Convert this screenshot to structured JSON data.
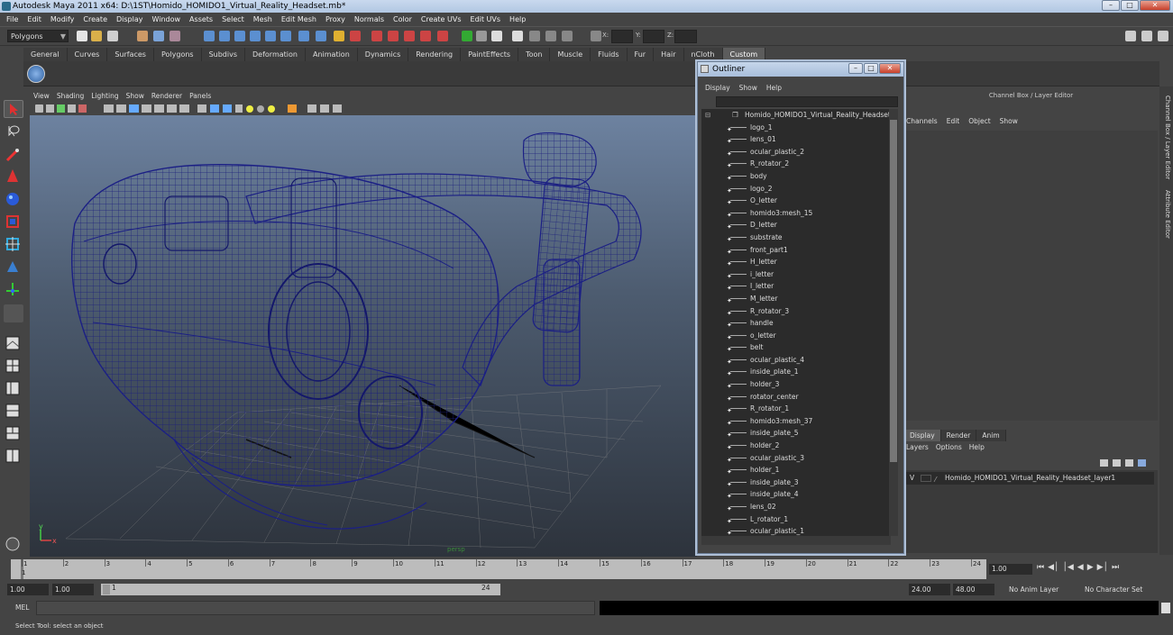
{
  "window": {
    "title": "Autodesk Maya 2011 x64: D:\\1ST\\Homido_HOMIDO1_Virtual_Reality_Headset.mb*"
  },
  "menubar": [
    "File",
    "Edit",
    "Modify",
    "Create",
    "Display",
    "Window",
    "Assets",
    "Select",
    "Mesh",
    "Edit Mesh",
    "Proxy",
    "Normals",
    "Color",
    "Create UVs",
    "Edit UVs",
    "Help"
  ],
  "toolbar": {
    "mode": "Polygons",
    "x_label": "X:",
    "y_label": "Y:",
    "z_label": "Z:"
  },
  "shelf_tabs": [
    "General",
    "Curves",
    "Surfaces",
    "Polygons",
    "Subdivs",
    "Deformation",
    "Animation",
    "Dynamics",
    "Rendering",
    "PaintEffects",
    "Toon",
    "Muscle",
    "Fluids",
    "Fur",
    "Hair",
    "nCloth",
    "Custom"
  ],
  "shelf_active": "Custom",
  "viewport": {
    "menu": [
      "View",
      "Shading",
      "Lighting",
      "Show",
      "Renderer",
      "Panels"
    ],
    "camera_label": "persp",
    "axis_x": "x",
    "axis_y": "y"
  },
  "outliner": {
    "title": "Outliner",
    "menu": [
      "Display",
      "Show",
      "Help"
    ],
    "root": "Homido_HOMIDO1_Virtual_Reality_Headset",
    "items": [
      "logo_1",
      "lens_01",
      "ocular_plastic_2",
      "R_rotator_2",
      "body",
      "logo_2",
      "O_letter",
      "homido3:mesh_15",
      "D_letter",
      "substrate",
      "front_part1",
      "H_letter",
      "i_letter",
      "I_letter",
      "M_letter",
      "R_rotator_3",
      "handle",
      "o_letter",
      "belt",
      "ocular_plastic_4",
      "inside_plate_1",
      "holder_3",
      "rotator_center",
      "R_rotator_1",
      "homido3:mesh_37",
      "inside_plate_5",
      "holder_2",
      "ocular_plastic_3",
      "holder_1",
      "inside_plate_3",
      "inside_plate_4",
      "lens_02",
      "L_rotator_1",
      "ocular_plastic_1"
    ]
  },
  "channel_box": {
    "header": "Channel Box / Layer Editor",
    "menu": [
      "Channels",
      "Edit",
      "Object",
      "Show"
    ]
  },
  "layer_editor": {
    "tabs": [
      "Display",
      "Render",
      "Anim"
    ],
    "active_tab": "Display",
    "menu": [
      "Layers",
      "Options",
      "Help"
    ],
    "layer_visible": "V",
    "layer_name": "Homido_HOMIDO1_Virtual_Reality_Headset_layer1"
  },
  "side_tabs": [
    "Channel Box / Layer Editor",
    "Attribute Editor"
  ],
  "timeline": {
    "ticks": [
      "1",
      "2",
      "3",
      "4",
      "5",
      "6",
      "7",
      "8",
      "9",
      "10",
      "11",
      "12",
      "13",
      "14",
      "15",
      "16",
      "17",
      "18",
      "19",
      "20",
      "21",
      "22",
      "23",
      "24"
    ],
    "current_frame": "1.00",
    "current_marker": "1"
  },
  "range": {
    "start": "1.00",
    "start_inner": "1.00",
    "range_start_label": "1",
    "range_end_label": "24",
    "end_inner": "24.00",
    "end": "48.00",
    "anim_layer": "No Anim Layer",
    "char_set": "No Character Set"
  },
  "command_line": {
    "label": "MEL"
  },
  "help_line": "Select Tool: select an object"
}
